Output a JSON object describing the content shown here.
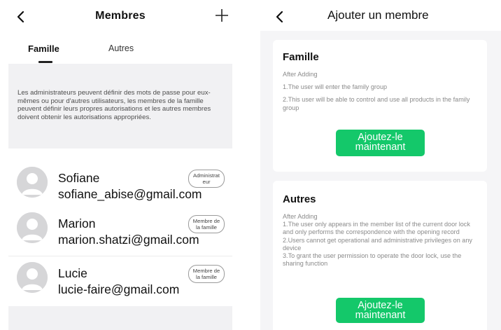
{
  "members_screen": {
    "title": "Membres",
    "tabs": [
      {
        "label": "Famille",
        "active": true
      },
      {
        "label": "Autres",
        "active": false
      }
    ],
    "info_text": "Les administrateurs peuvent définir des mots de passe pour eux-mêmes ou pour d'autres utilisateurs, les membres de la famille peuvent définir leurs propres autorisations et les autres membres doivent obtenir les autorisations appropriées.",
    "members": [
      {
        "name": "Sofiane",
        "email": "sofiane_abise@gmail.com",
        "role_line1": "Administrat",
        "role_line2": "eur"
      },
      {
        "name": "Marion",
        "email": "marion.shatzi@gmail.com",
        "role_line1": "Membre de",
        "role_line2": "la famille"
      },
      {
        "name": "Lucie",
        "email": "lucie-faire@gmail.com",
        "role_line1": "Membre de",
        "role_line2": "la famille"
      }
    ],
    "icons": {
      "back": "chevron-left-icon",
      "add": "plus-icon",
      "avatar": "user-avatar-icon"
    }
  },
  "add_member_screen": {
    "title": "Ajouter un membre",
    "famille_card": {
      "title": "Famille",
      "line1": "After Adding",
      "line2": "1.The user will enter the family group",
      "line3": "2.This user will be able to control and use all products in the family group",
      "button_line1": "Ajoutez-le",
      "button_line2": "maintenant"
    },
    "autres_card": {
      "title": "Autres",
      "line1": "After Adding",
      "line2": "1.The user only appears in the member list of the current door lock and only performs the correspondence with the opening record",
      "line3": "2.Users cannot get operational and administrative privileges on any device",
      "line4": "3.To grant the user permission to operate the door lock, use the sharing function",
      "button_line1": "Ajoutez-le",
      "button_line2": "maintenant"
    }
  },
  "colors": {
    "accent_green": "#14c86a",
    "panel_gray": "#f1f1f3",
    "secondary_text": "#8a8a8a"
  }
}
